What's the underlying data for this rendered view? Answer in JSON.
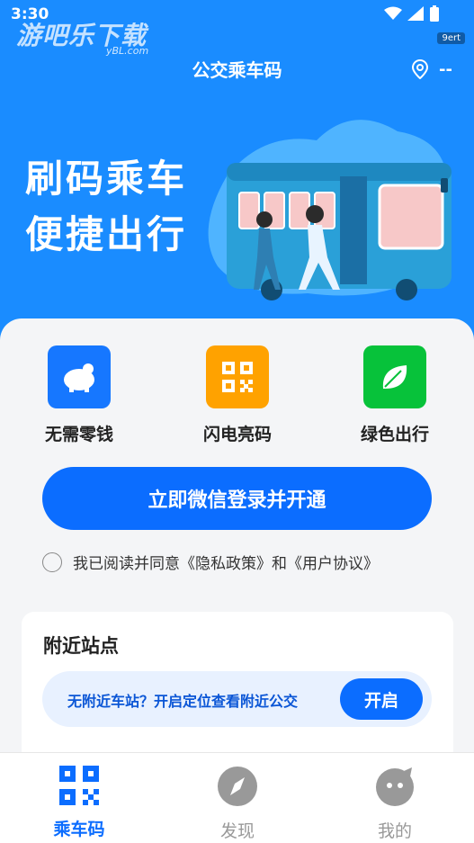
{
  "status": {
    "time": "3:30",
    "watermark": "游吧乐下载",
    "watermark_sub": "yBL.com",
    "corner_tag": "9ert"
  },
  "header": {
    "title": "公交乘车码",
    "location_value": "--"
  },
  "banner": {
    "line1": "刷码乘车",
    "line2": "便捷出行"
  },
  "features": [
    {
      "label": "无需零钱",
      "icon": "piggy-bank-icon",
      "color": "#1677ff"
    },
    {
      "label": "闪电亮码",
      "icon": "qr-code-icon",
      "color": "#ffa200"
    },
    {
      "label": "绿色出行",
      "icon": "leaf-icon",
      "color": "#07c23a"
    }
  ],
  "login_button": "立即微信登录并开通",
  "agreement": "我已阅读并同意《隐私政策》和《用户协议》",
  "nearby": {
    "title": "附近站点",
    "message": "无附近车站？开启定位查看附近公交",
    "open_button": "开启"
  },
  "tabs": [
    {
      "label": "乘车码",
      "icon": "qr-code-icon",
      "active": true
    },
    {
      "label": "发现",
      "icon": "compass-icon",
      "active": false
    },
    {
      "label": "我的",
      "icon": "profile-icon",
      "active": false
    }
  ],
  "colors": {
    "primary": "#1a8cff",
    "accent": "#0b6dff",
    "tab_active": "#0b6dff",
    "tab_inactive": "#999999"
  }
}
